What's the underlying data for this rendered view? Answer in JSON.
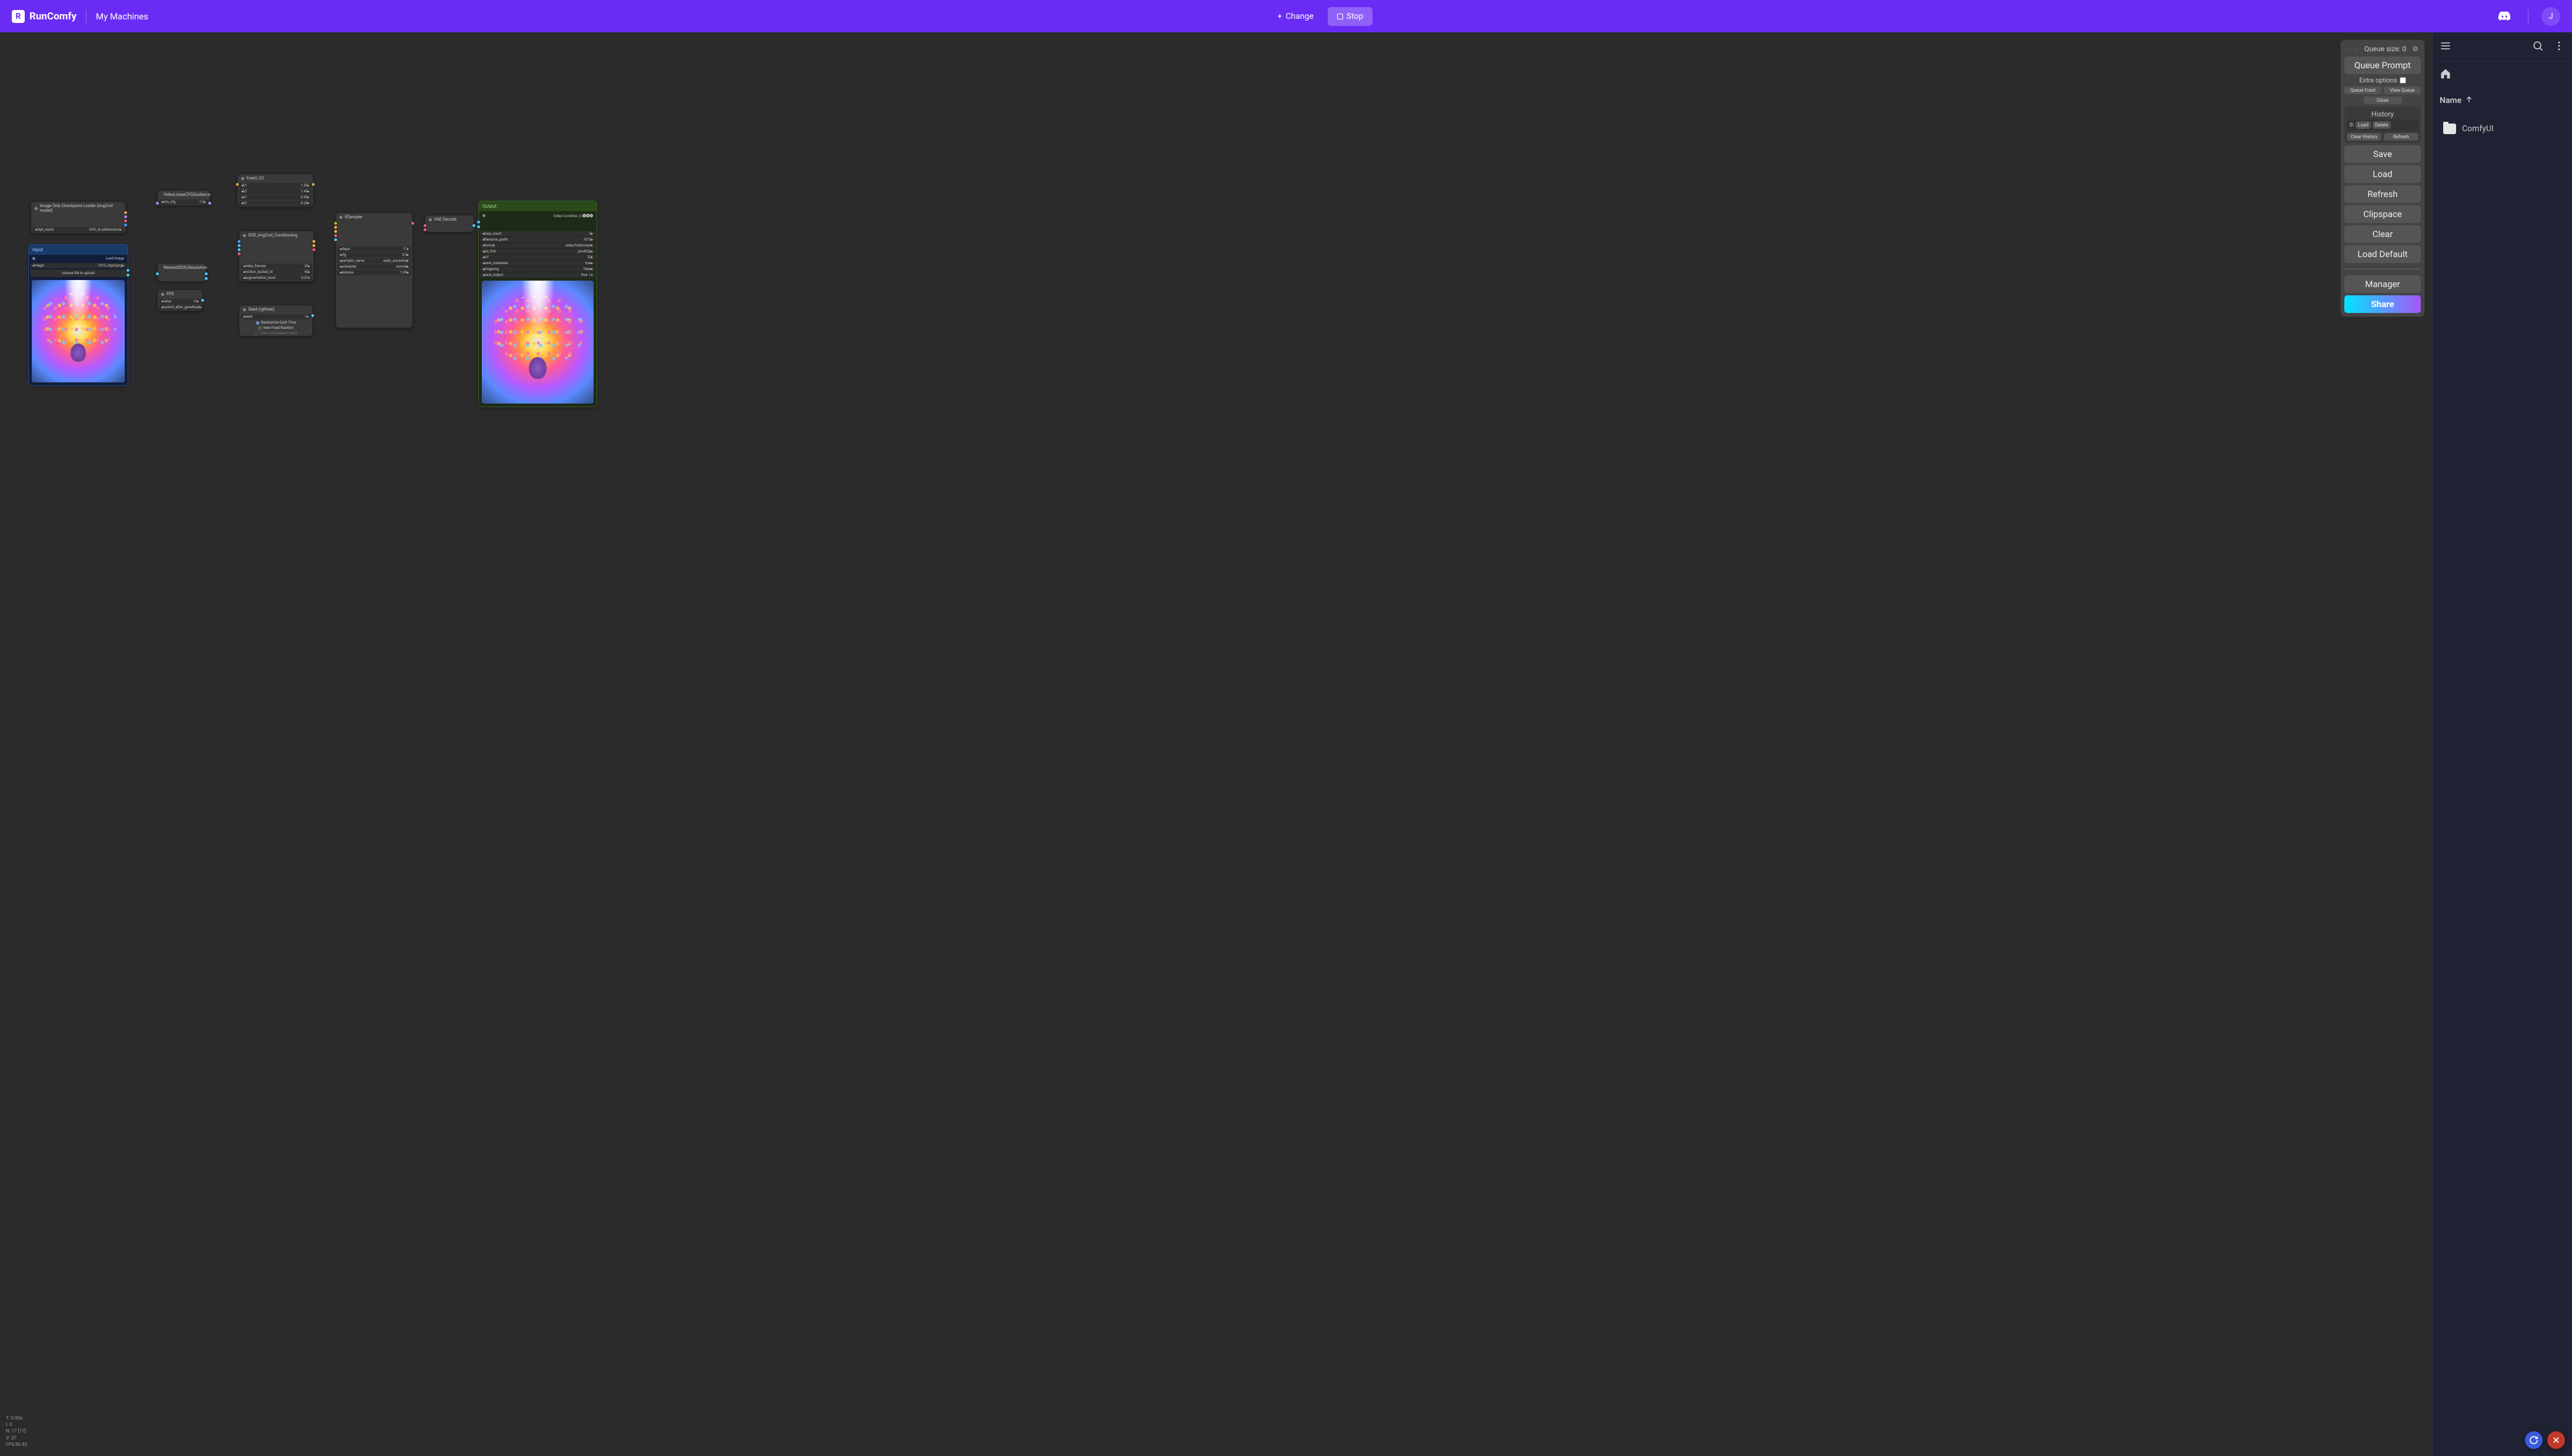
{
  "topbar": {
    "logo": "RunComfy",
    "nav": "My Machines",
    "change": "Change",
    "stop": "Stop",
    "avatar": "J"
  },
  "panel": {
    "queue": "Queue size: 0",
    "queue_prompt": "Queue Prompt",
    "extra": "Extra options",
    "queue_front": "Queue Front",
    "view_queue": "View Queue",
    "close": "Close",
    "history": "History",
    "hist_item": "0:",
    "hist_load": "Load",
    "hist_delete": "Delete",
    "clear_history": "Clear History",
    "refresh_btn": "Refresh",
    "save": "Save",
    "load": "Load",
    "refresh": "Refresh",
    "clipspace": "Clipspace",
    "clear": "Clear",
    "load_default": "Load Default",
    "manager": "Manager",
    "share": "Share"
  },
  "sidebar": {
    "name_header": "Name",
    "folder": "ComfyUI"
  },
  "stats": {
    "t": "T: 0.00s",
    "i": "I: 0",
    "n": "N: 17 [17]",
    "v": "V: 37",
    "fps": "FPS:56.82"
  },
  "nodes": {
    "ckpt": {
      "title": "Image Only Checkpoint Loader (img2vid model)",
      "row1_l": "ckpt_name",
      "row1_r": "SVD_xt.safetensors"
    },
    "cfg": {
      "title": "VideoLinearCFGGuidance",
      "row1_l": "min_cfg",
      "row1_r": "1.0"
    },
    "input": {
      "title": "Input",
      "sub": "Load Image",
      "row1_l": "image",
      "row1_r": "1015_input.png",
      "upload": "choose file to upload"
    },
    "res": {
      "title": "NearestSDXLResolution"
    },
    "fps": {
      "title": "FPS",
      "row1_l": "value",
      "row1_r": "12",
      "row2_l": "control_after_gene",
      "row2_r": "fixed"
    },
    "freeu": {
      "title": "FreeU_V2",
      "rows": [
        [
          "b1",
          "1.30"
        ],
        [
          "b2",
          "1.40"
        ],
        [
          "s1",
          "0.90"
        ],
        [
          "s2",
          "0.20"
        ]
      ]
    },
    "svd": {
      "title": "SVD_img2vid_Conditioning",
      "rows": [
        [
          "video_frames",
          "25"
        ],
        [
          "motion_bucket_id",
          "40"
        ],
        [
          "augmentation_level",
          "0.01"
        ]
      ]
    },
    "seed": {
      "title": "Seed (rgthree)",
      "row1_l": "seed",
      "row1_r": "-1",
      "opt1": "Randomize Each Time",
      "opt2": "New Fixed Random",
      "opt3": "(Use Last Queued Seed)"
    },
    "ksampler": {
      "title": "KSampler",
      "rows": [
        [
          "steps",
          "17"
        ],
        [
          "cfg",
          "3.5"
        ],
        [
          "sampler_name",
          "euler_ancestral"
        ],
        [
          "scheduler",
          "normal"
        ],
        [
          "denoise",
          "1.00"
        ]
      ]
    },
    "vae": {
      "title": "VAE Decode"
    },
    "output": {
      "title": "Output",
      "sub": "Video Combine 🎥🅥🅗🅢",
      "rows": [
        [
          "loop_count",
          "0"
        ],
        [
          "filename_prefix",
          "1015"
        ],
        [
          "format",
          "video/h264-mp4"
        ],
        [
          "pix_fmt",
          "yuv420p"
        ],
        [
          "crf",
          "20"
        ],
        [
          "save_metadata",
          "true"
        ],
        [
          "pingpong",
          "false"
        ],
        [
          "save_output",
          "true ✓"
        ]
      ]
    }
  }
}
